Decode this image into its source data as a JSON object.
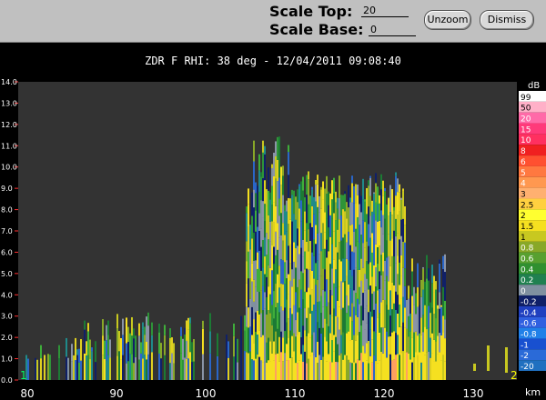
{
  "toolbar": {
    "scale_top_label": "Scale Top:",
    "scale_top_value": "20",
    "scale_base_label": "Scale Base:",
    "scale_base_value": "0",
    "unzoom_label": "Unzoom",
    "dismiss_label": "Dismiss"
  },
  "plot": {
    "title": "ZDR F  RHI: 38 deg  -  12/04/2011 09:08:40",
    "x_unit": "km",
    "y_ticks": [
      "0.0",
      "1.0",
      "2.0",
      "3.0",
      "4.0",
      "5.0",
      "6.0",
      "7.0",
      "8.0",
      "9.0",
      "10.0",
      "11.0",
      "12.0",
      "13.0",
      "14.0"
    ],
    "x_ticks": [
      "80",
      "90",
      "100",
      "110",
      "120",
      "130"
    ],
    "corner_left": "1",
    "corner_right": "2",
    "background_color": "#333333"
  },
  "colorbar": {
    "unit": "dB",
    "labels": [
      "99",
      "50",
      "20",
      "15",
      "10",
      "8",
      "6",
      "5",
      "4",
      "3",
      "2.5",
      "2",
      "1.5",
      "1",
      "0.8",
      "0.6",
      "0.4",
      "0.2",
      "0",
      "-0.2",
      "-0.4",
      "-0.6",
      "-0.8",
      "-1",
      "-2",
      "-20"
    ],
    "colors": [
      "#ffffff",
      "#ffb0c8",
      "#ff6aa8",
      "#ff3a7a",
      "#ff3060",
      "#f02020",
      "#ff5030",
      "#ff7840",
      "#ff9850",
      "#ffb070",
      "#ffd040",
      "#ffff30",
      "#f5e020",
      "#c8c820",
      "#88a828",
      "#58a030",
      "#309030",
      "#208050",
      "#8090a0",
      "#102068",
      "#2040c0",
      "#3060e0",
      "#2080e8",
      "#1850d0",
      "#2a6ad8",
      "#2070c0"
    ]
  }
}
